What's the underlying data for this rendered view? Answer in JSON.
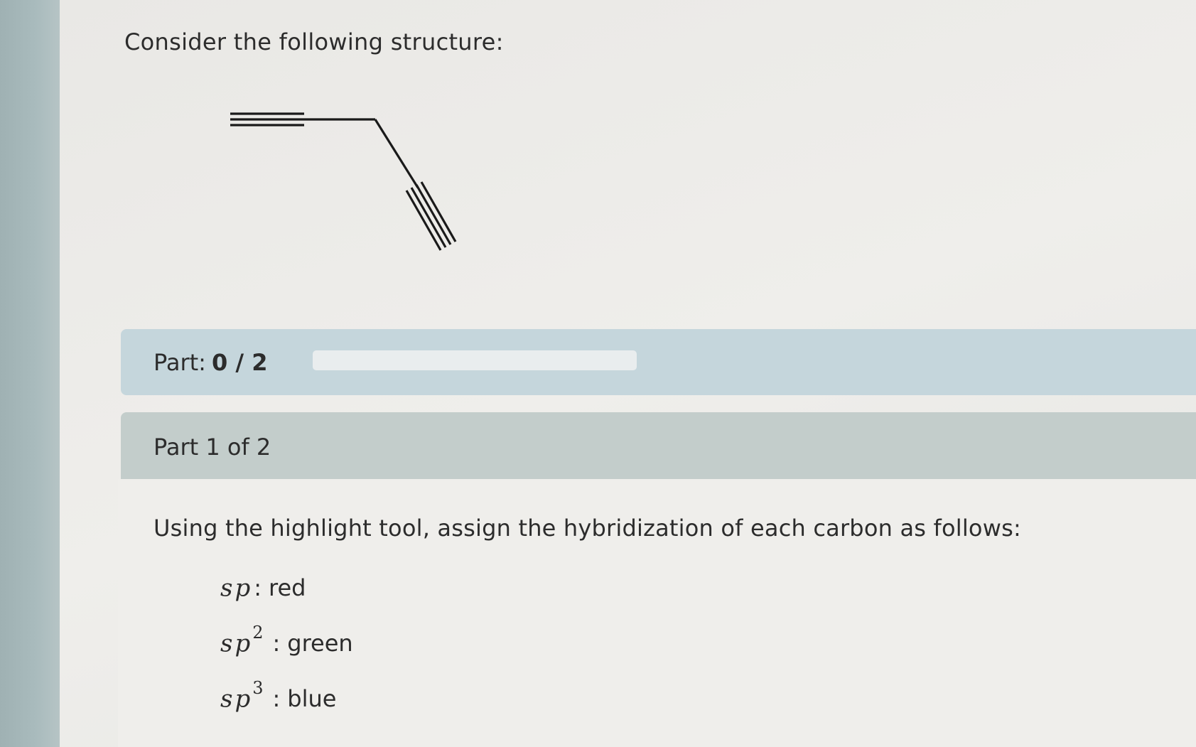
{
  "question": {
    "prompt": "Consider the following structure:"
  },
  "progress": {
    "label": "Part:",
    "value": "0 / 2",
    "fraction": 0
  },
  "section": {
    "title": "Part 1 of 2",
    "instruction": "Using the highlight tool, assign the hybridization of each carbon as follows:",
    "legend": [
      {
        "hybridization": "sp",
        "superscript": "",
        "colon": ":",
        "color": "red"
      },
      {
        "hybridization": "sp",
        "superscript": "2",
        "colon": ":",
        "color": "green"
      },
      {
        "hybridization": "sp",
        "superscript": "3",
        "colon": ":",
        "color": "blue"
      }
    ]
  },
  "colors": {
    "part_bar": "#c5d6dc",
    "section_header": "#c3cdcb",
    "side_strip": "#a9bbbd",
    "bond": "#1a1a1a"
  }
}
